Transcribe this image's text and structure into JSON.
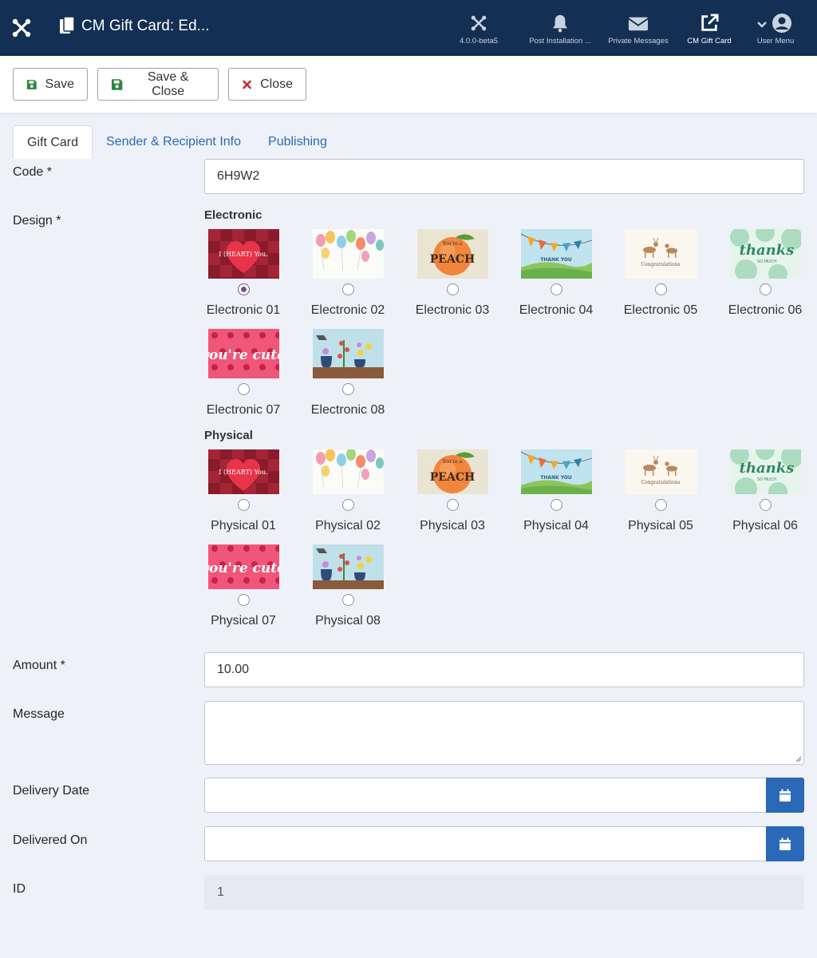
{
  "header": {
    "title": "CM Gift Card: Ed...",
    "items": [
      {
        "label": "4.0.0-beta5",
        "icon": "joomla-icon"
      },
      {
        "label": "Post Installation ...",
        "icon": "bell-icon"
      },
      {
        "label": "Private Messages",
        "icon": "envelope-icon"
      },
      {
        "label": "CM Gift Card",
        "icon": "external-link-icon"
      },
      {
        "label": "User Menu",
        "icon": "user-circle-icon"
      }
    ]
  },
  "toolbar": {
    "save": "Save",
    "save_close": "Save & Close",
    "close": "Close"
  },
  "tabs": [
    "Gift Card",
    "Sender & Recipient Info",
    "Publishing"
  ],
  "form": {
    "code_label": "Code *",
    "code_value": "6H9W2",
    "design_label": "Design *",
    "electronic_title": "Electronic",
    "physical_title": "Physical",
    "electronic": [
      "Electronic 01",
      "Electronic 02",
      "Electronic 03",
      "Electronic 04",
      "Electronic 05",
      "Electronic 06",
      "Electronic 07",
      "Electronic 08"
    ],
    "physical": [
      "Physical 01",
      "Physical 02",
      "Physical 03",
      "Physical 04",
      "Physical 05",
      "Physical 06",
      "Physical 07",
      "Physical 08"
    ],
    "selected_design": "Electronic 01",
    "card_art_text": {
      "heart": "I (HEART) You.",
      "peach": "PEACH",
      "peach_small": "You're a",
      "thank_you": "THANK YOU",
      "congrats": "Congratulations",
      "thanks": "thanks",
      "thanks_small": "SO MUCH",
      "cute": "you're cute"
    },
    "amount_label": "Amount *",
    "amount_value": "10.00",
    "message_label": "Message",
    "message_value": "",
    "delivery_date_label": "Delivery Date",
    "delivery_date_value": "",
    "delivered_on_label": "Delivered On",
    "delivered_on_value": "",
    "id_label": "ID",
    "id_value": "1"
  },
  "colors": {
    "header_bg": "#132f53",
    "accent": "#2a69b8",
    "save_icon": "#2e8540",
    "close_icon": "#c52827",
    "radio_checked": "#7b4f8c"
  }
}
